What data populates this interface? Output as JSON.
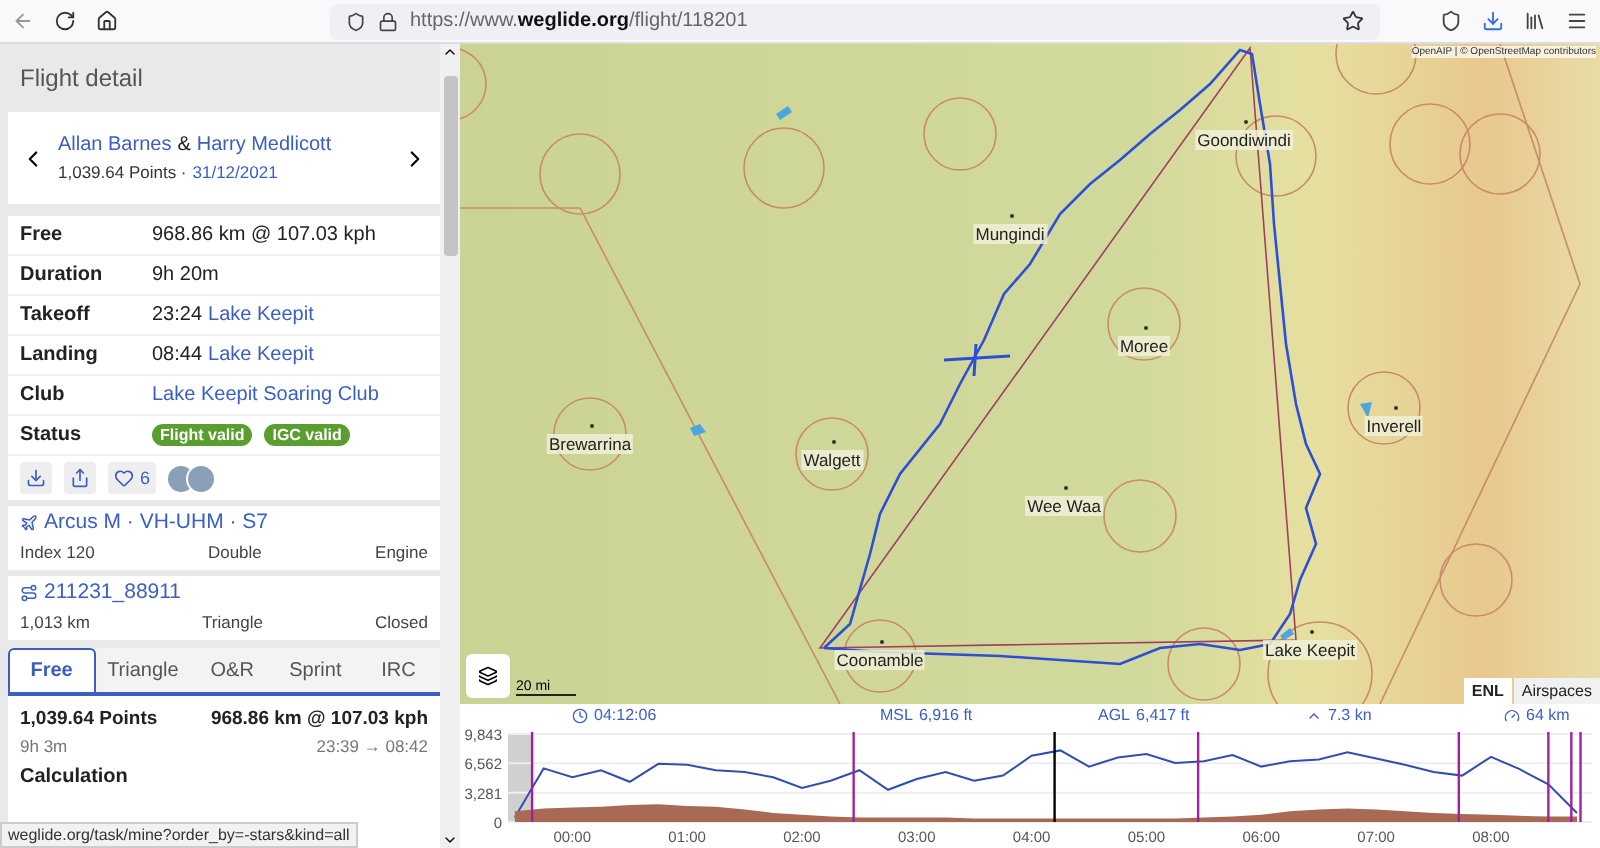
{
  "browser": {
    "url": "https://www.**weglide.org**/flight/118201",
    "status_link": "weglide.org/task/mine?order_by=-stars&kind=all"
  },
  "sidebar": {
    "title": "Flight detail",
    "pilots": [
      "Allan Barnes",
      "Harry Medlicott"
    ],
    "pilot_joiner": "&",
    "points": "1,039.64 Points ·",
    "date": "31/12/2021",
    "details": [
      {
        "label": "Free",
        "value": "968.86 km @ 107.03 kph",
        "kind": "text"
      },
      {
        "label": "Duration",
        "value": "9h 20m",
        "kind": "text"
      },
      {
        "label": "Takeoff",
        "time": "23:24",
        "value": "Lake Keepit",
        "kind": "place"
      },
      {
        "label": "Landing",
        "time": "08:44",
        "value": "Lake Keepit",
        "kind": "place"
      },
      {
        "label": "Club",
        "value": "Lake Keepit Soaring Club",
        "kind": "link"
      },
      {
        "label": "Status",
        "badges": [
          "Flight valid",
          "IGC valid"
        ],
        "kind": "badges"
      }
    ],
    "likes": "6",
    "aircraft": {
      "name": "Arcus M · VH-UHM · S7",
      "index": "Index 120",
      "seats": "Double",
      "propulsion": "Engine"
    },
    "task": {
      "name": "211231_88911",
      "distance": "1,013 km",
      "type": "Triangle",
      "state": "Closed"
    },
    "tabs": [
      {
        "label": "Free",
        "selected": true
      },
      {
        "label": "Triangle",
        "selected": false
      },
      {
        "label": "O&R",
        "selected": false
      },
      {
        "label": "Sprint",
        "selected": false
      },
      {
        "label": "IRC",
        "selected": false
      }
    ],
    "score": {
      "points": "1,039.64 Points",
      "distance_speed": "968.86 km @ 107.03 kph",
      "duration": "9h 3m",
      "times": "23:39 → 08:42"
    },
    "section": "Calculation"
  },
  "map": {
    "attribution": "OpenAIP | © OpenStreetMap contributors",
    "scale": "20 mi",
    "places": [
      "Goondiwindi",
      "Mungindi",
      "Moree",
      "Inverell",
      "Brewarrina",
      "Walgett",
      "Wee Waa",
      "Coonamble",
      "Lake Keepit"
    ],
    "toggles": [
      {
        "label": "ENL",
        "selected": true
      },
      {
        "label": "Airspaces",
        "selected": false
      }
    ]
  },
  "barogram": {
    "time": "04:12:06",
    "msl_label": "MSL",
    "msl": "6,916 ft",
    "agl_label": "AGL",
    "agl": "6,417 ft",
    "climb": "7.3 kn",
    "distance": "64 km",
    "chart_data": {
      "type": "line",
      "x": [
        -0.5,
        -0.25,
        0,
        0.25,
        0.5,
        0.75,
        1,
        1.25,
        1.5,
        1.75,
        2,
        2.25,
        2.5,
        2.75,
        3,
        3.25,
        3.5,
        3.75,
        4,
        4.25,
        4.5,
        4.75,
        5,
        5.25,
        5.5,
        5.75,
        6,
        6.25,
        6.5,
        6.75,
        7,
        7.25,
        7.5,
        7.75,
        8,
        8.25,
        8.5,
        8.75
      ],
      "series": [
        {
          "type": "line",
          "color": "#2f4fb0",
          "values": [
            500,
            6000,
            5000,
            5800,
            4500,
            6500,
            6400,
            5800,
            5600,
            5000,
            3800,
            4600,
            5800,
            3600,
            4800,
            5600,
            4600,
            5200,
            7400,
            8000,
            6200,
            7200,
            7600,
            6600,
            6800,
            7500,
            6200,
            6800,
            7000,
            7800,
            7100,
            6400,
            5600,
            5200,
            7300,
            5900,
            4200,
            1000
          ]
        },
        {
          "type": "area",
          "color": "#a86a55",
          "values": [
            1200,
            1500,
            1600,
            1700,
            1900,
            2000,
            1800,
            1700,
            1400,
            1000,
            800,
            600,
            500,
            500,
            500,
            500,
            400,
            400,
            400,
            400,
            400,
            400,
            400,
            400,
            500,
            600,
            800,
            1200,
            1400,
            1500,
            1400,
            1200,
            1000,
            900,
            800,
            700,
            600,
            600
          ]
        }
      ],
      "xlim": [
        -0.56,
        8.88
      ],
      "ylim": [
        0,
        9843
      ],
      "xticks": [
        {
          "value": 0,
          "label": "00:00"
        },
        {
          "value": 1,
          "label": "01:00"
        },
        {
          "value": 2,
          "label": "02:00"
        },
        {
          "value": 3,
          "label": "03:00"
        },
        {
          "value": 4,
          "label": "04:00"
        },
        {
          "value": 5,
          "label": "05:00"
        },
        {
          "value": 6,
          "label": "06:00"
        },
        {
          "value": 7,
          "label": "07:00"
        },
        {
          "value": 8,
          "label": "08:00"
        }
      ],
      "yticks": [
        {
          "value": 0,
          "label": "0"
        },
        {
          "value": 3281,
          "label": "3,281"
        },
        {
          "value": 6562,
          "label": "6,562"
        },
        {
          "value": 9843,
          "label": "9,843"
        }
      ],
      "bands": [
        {
          "axis": "x",
          "from": -0.56,
          "to": -0.35,
          "color": "#d0d0d0"
        }
      ],
      "ref_lines": [
        {
          "axis": "x",
          "value": -0.35,
          "color": "#a020a0"
        },
        {
          "axis": "x",
          "value": 2.45,
          "color": "#a020a0"
        },
        {
          "axis": "x",
          "value": 4.2,
          "color": "#000000"
        },
        {
          "axis": "x",
          "value": 5.45,
          "color": "#a020a0"
        },
        {
          "axis": "x",
          "value": 7.72,
          "color": "#a020a0"
        },
        {
          "axis": "x",
          "value": 8.5,
          "color": "#a020a0"
        },
        {
          "axis": "x",
          "value": 8.7,
          "color": "#a020a0"
        },
        {
          "axis": "x",
          "value": 8.78,
          "color": "#a020a0"
        }
      ]
    }
  }
}
